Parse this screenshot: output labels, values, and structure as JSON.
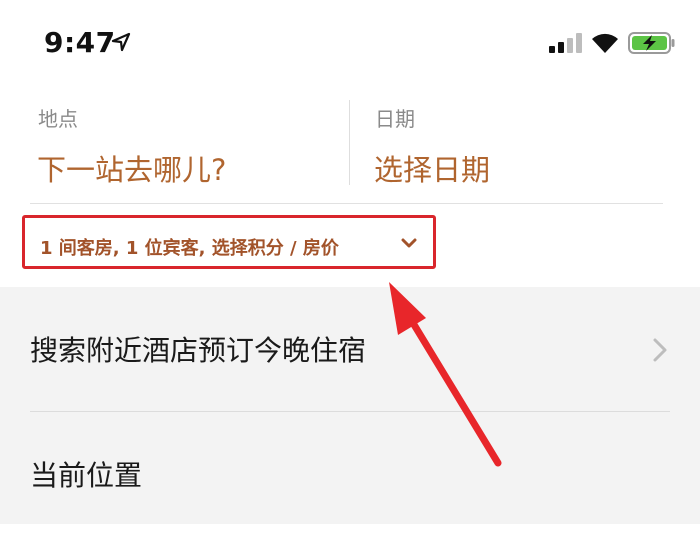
{
  "status_bar": {
    "time": "9:47",
    "icons": [
      "location-arrow-icon",
      "signal-icon",
      "wifi-icon",
      "battery-charging-icon"
    ],
    "battery_color": "#5cc445"
  },
  "search": {
    "location_label": "地点",
    "location_placeholder": "下一站去哪儿?",
    "date_label": "日期",
    "date_placeholder": "选择日期",
    "room_selector_text": "1 间客房, 1 位宾客, 选择积分 / 房价"
  },
  "list": {
    "items": [
      {
        "label": "搜索附近酒店预订今晚住宿",
        "has_chevron": true
      },
      {
        "label": "当前位置",
        "has_chevron": false
      }
    ]
  },
  "colors": {
    "accent": "#b0652f",
    "highlight_border": "#d9262c",
    "annotation_arrow": "#e8262a",
    "list_background": "#f3f3f3"
  }
}
